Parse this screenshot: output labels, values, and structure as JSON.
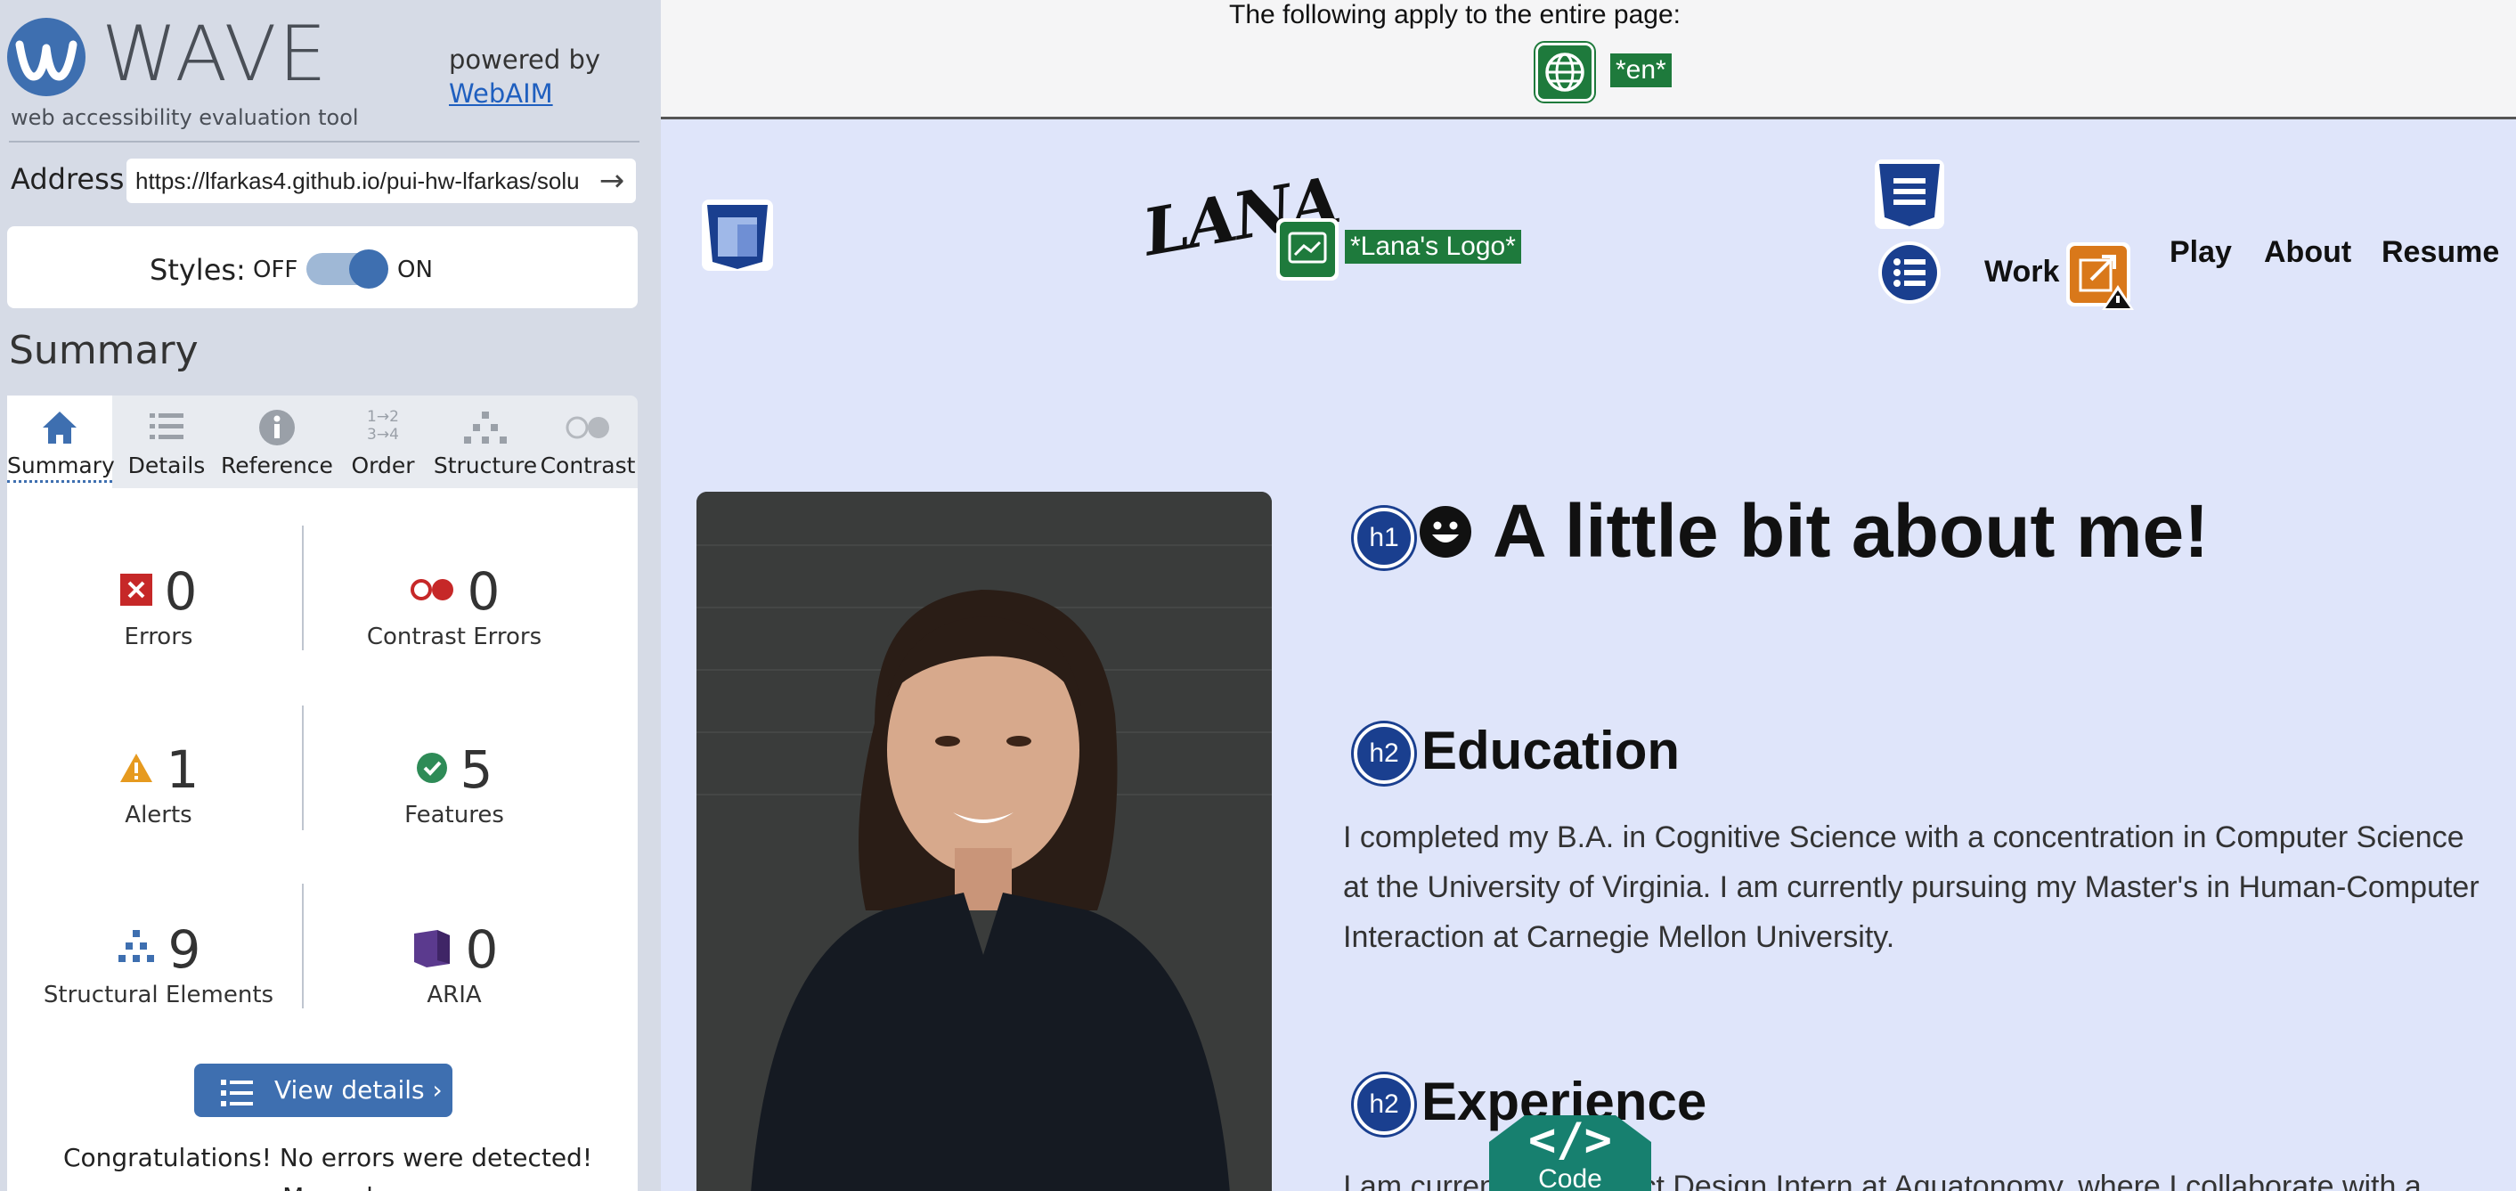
{
  "wave": {
    "logo_text": "WAVE",
    "tagline": "web accessibility evaluation tool",
    "powered_by": "powered by",
    "webaim_link": "WebAIM",
    "address_label": "Address:",
    "address_value": "https://lfarkas4.github.io/pui-hw-lfarkas/solu",
    "styles_label": "Styles:",
    "styles_off": "OFF",
    "styles_on": "ON",
    "summary_heading": "Summary",
    "tabs": [
      {
        "label": "Summary",
        "icon": "home-icon",
        "active": true
      },
      {
        "label": "Details",
        "icon": "list-icon"
      },
      {
        "label": "Reference",
        "icon": "info-icon"
      },
      {
        "label": "Order",
        "icon": "order-icon",
        "icon_text_top": "1→2",
        "icon_text_bottom": "3→4"
      },
      {
        "label": "Structure",
        "icon": "structure-icon"
      },
      {
        "label": "Contrast",
        "icon": "contrast-icon"
      }
    ],
    "stats": [
      {
        "count": "0",
        "label": "Errors",
        "icon": "error-icon",
        "color": "#c62828"
      },
      {
        "count": "0",
        "label": "Contrast Errors",
        "icon": "contrast-error-icon",
        "color": "#c62828"
      },
      {
        "count": "1",
        "label": "Alerts",
        "icon": "alert-icon",
        "color": "#e69a1f"
      },
      {
        "count": "5",
        "label": "Features",
        "icon": "feature-icon",
        "color": "#2e8b57"
      },
      {
        "count": "9",
        "label": "Structural Elements",
        "icon": "structure-elements-icon",
        "color": "#3e6fb0"
      },
      {
        "count": "0",
        "label": "ARIA",
        "icon": "aria-icon",
        "color": "#5b3a8e"
      }
    ],
    "view_details": "View details ›",
    "congrats": "Congratulations! No errors were detected! Manual"
  },
  "page": {
    "lang_banner_text": "The following apply to the entire page:",
    "lang_code": "*en*",
    "logo_text": "LANA",
    "logo_alt": "*Lana's Logo*",
    "nav": [
      "Work",
      "Play",
      "About",
      "Resume"
    ],
    "h1_badge": "h1",
    "h1": "A little bit about me!",
    "h2_badge": "h2",
    "sections": [
      {
        "heading": "Education",
        "text": "I completed my B.A. in Cognitive Science with a concentration in Computer Science at the University of Virginia. I am currently pursuing my Master's in Human-Computer Interaction at Carnegie Mellon University."
      },
      {
        "heading": "Experience",
        "text": "I am currently a Product Design Intern at Aquatonomy, where I collaborate with a"
      }
    ],
    "code_label": "Code",
    "code_glyph": "</>"
  },
  "colors": {
    "wave_blue": "#3e6fb0",
    "feature_green": "#1e7a3c",
    "heading_badge": "#1a3f8f",
    "alert_orange": "#d9781a",
    "page_bg": "#dfe5fa"
  }
}
